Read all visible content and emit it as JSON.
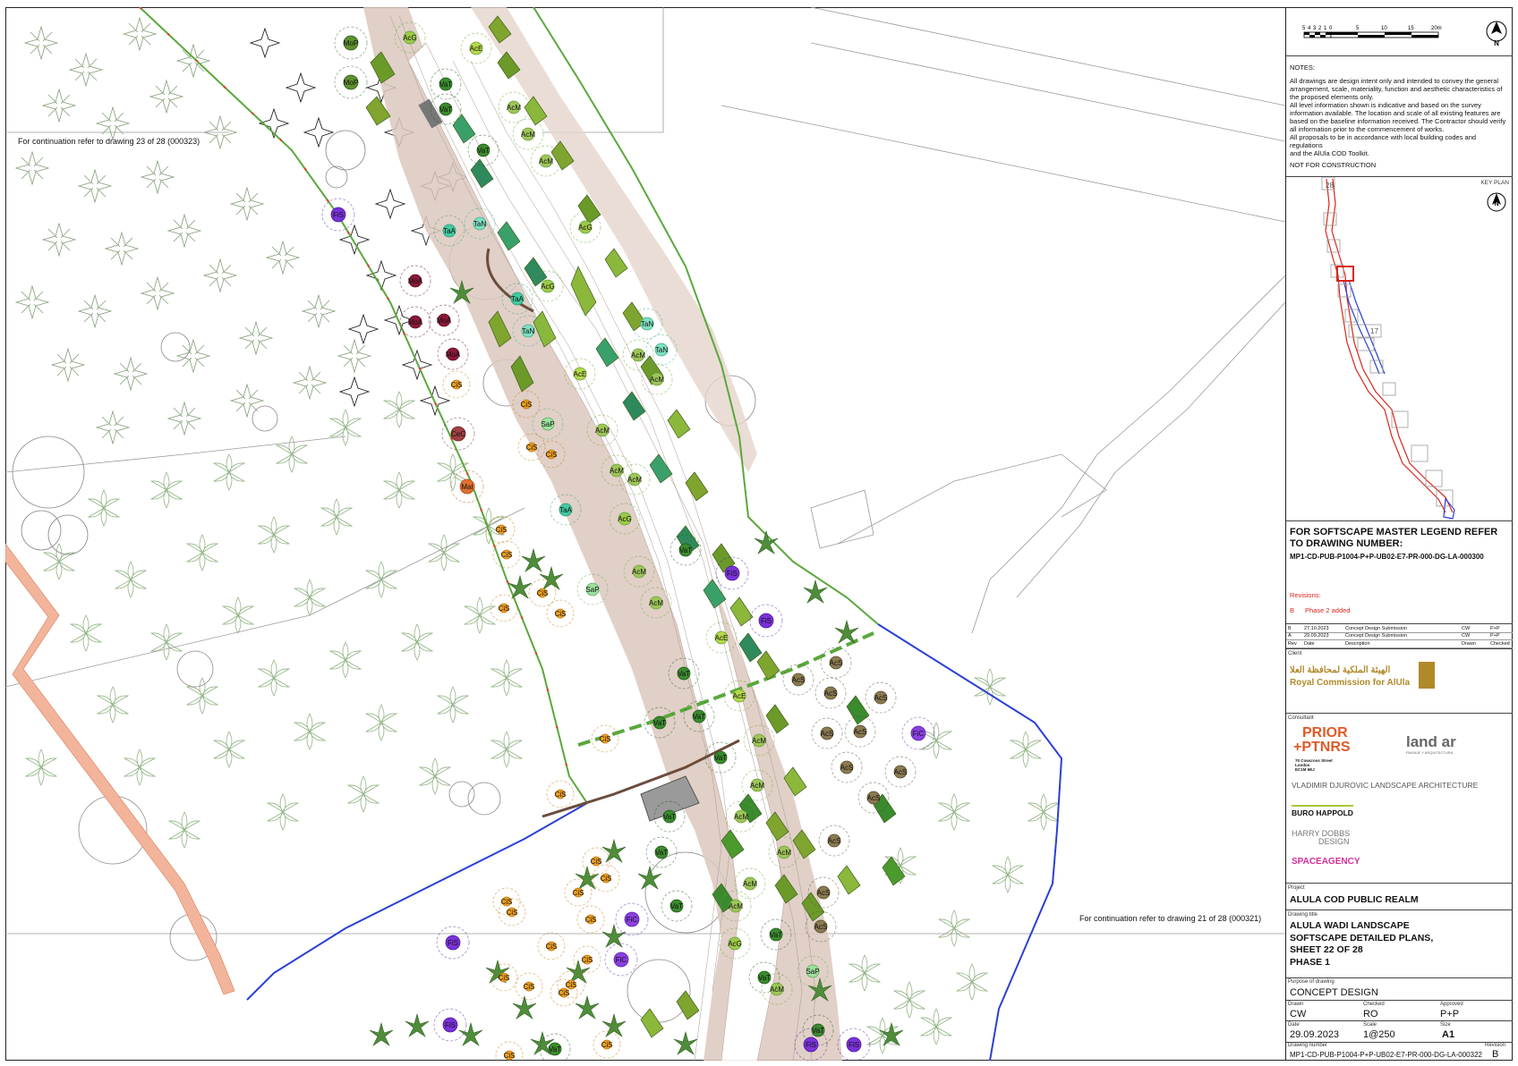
{
  "continuation": {
    "top_left": "For continuation refer to drawing 23 of 28 (000323)",
    "bottom_right": "For continuation refer to drawing 21 of 28 (000321)"
  },
  "scale_bar": {
    "labels": [
      "5",
      "4",
      "3",
      "2",
      "1",
      "0",
      "5",
      "10",
      "15",
      "20m"
    ]
  },
  "north_label": "N",
  "notes": {
    "heading": "NOTES:",
    "lines": [
      "All drawings are design intent only and intended to convey the general",
      "arrangement, scale, materiality, function and aesthetic characteristics of",
      "the proposed elements only.",
      "All level information shown is indicative and based on the survey",
      "information available. The location and scale of all existing features are",
      "based on the baseline information received. The Contractor should verify",
      "all information prior to the commencement of works.",
      "All proposals to be in accordance with local building codes and regulations",
      "and the AlUla COD Toolkit."
    ],
    "footer": "NOT FOR CONSTRUCTION"
  },
  "key_plan": {
    "label": "KEY PLAN",
    "sheet_numbers": [
      "28",
      "17"
    ]
  },
  "legend_ref": {
    "line1": "FOR SOFTSCAPE MASTER LEGEND REFER",
    "line2": "TO DRAWING NUMBER:",
    "line3": "MP1-CD-PUB-P1004-P+P-UB02-E7-PR-000-DG-LA-000300"
  },
  "revisions": {
    "heading": "Revisions:",
    "note_rev": "B",
    "note_text": "Phase 2 added",
    "rows": [
      {
        "rev": "B",
        "date": "27.10.2023",
        "desc": "Concept Design Submission",
        "drawn": "CW",
        "checked": "P+P"
      },
      {
        "rev": "A",
        "date": "29.09.2023",
        "desc": "Concept Design Submission",
        "drawn": "CW",
        "checked": "P+P"
      }
    ],
    "headers": {
      "rev": "Rev",
      "date": "Date",
      "desc": "Description",
      "drawn": "Drawn",
      "checked": "Checked"
    }
  },
  "client": {
    "label": "Client",
    "arabic": "الهيئة الملكية لمحافظة العلا",
    "english": "Royal Commission for AlUla"
  },
  "consultant": {
    "label": "Consultant",
    "prior_line1": "PRIOR",
    "prior_line2": "+PTNRS",
    "prior_addr": [
      "70 Cowcross Street",
      "London",
      "EC1M 6EJ"
    ],
    "landar": "land ar",
    "landar_sub": "PAISAJE Y ARQUITECTURA",
    "vladimir": "VLADIMIR DJUROVIC LANDSCAPE ARCHITECTURE",
    "buro": "BURO HAPPOLD",
    "harry_line1": "HARRY DOBBS",
    "harry_line2": "DESIGN",
    "spaceagency": "SPACEAGENCY"
  },
  "project": {
    "label": "Project",
    "name": "ALULA COD PUBLIC REALM"
  },
  "drawing_title": {
    "label": "Drawing title",
    "lines": [
      "ALULA WADI LANDSCAPE",
      "SOFTSCAPE DETAILED PLANS,",
      "SHEET 22 OF 28",
      "PHASE 1"
    ]
  },
  "purpose": {
    "label": "Purpose of drawing",
    "value": "CONCEPT DESIGN"
  },
  "meta": {
    "drawn_label": "Drawn",
    "drawn": "CW",
    "checked_label": "Checked",
    "checked": "RO",
    "approved_label": "Approved",
    "approved": "P+P",
    "date_label": "Date",
    "date": "29.09.2023",
    "scale_label": "Scale",
    "scale": "1@250",
    "size_label": "Size",
    "size": "A1"
  },
  "drawing_number": {
    "label": "Drawing number",
    "value": "MP1-CD-PUB-P1004-P+P-UB02-E7-PR-000-DG-LA-000322",
    "rev_label": "Revision",
    "rev": "B"
  },
  "colors": {
    "wadi_sand": "#d9c3b8",
    "boundary_green": "#5aa83c",
    "boundary_blue": "#2a3fd6",
    "boundary_red": "#e0402a",
    "palm_dark": "#3a6b2a",
    "acm_green": "#8bb83a",
    "vat_green": "#3b8a2e",
    "fis_purple": "#7a32d8",
    "cis_orange": "#f0a020",
    "moa_maroon": "#8a1838",
    "taa_teal": "#44c9a0",
    "acs_brown": "#8a7a50",
    "walkway_pink": "#f2b59b"
  },
  "plant_labels": [
    {
      "code": "MoP"
    },
    {
      "code": "MoP"
    },
    {
      "code": "AcG"
    },
    {
      "code": "AcE"
    },
    {
      "code": "VaT"
    },
    {
      "code": "VaT"
    },
    {
      "code": "AcM"
    },
    {
      "code": "AcM"
    },
    {
      "code": "AcM"
    },
    {
      "code": "VaT"
    },
    {
      "code": "FiS"
    },
    {
      "code": "TaA"
    },
    {
      "code": "TaN"
    },
    {
      "code": "AcG"
    },
    {
      "code": "MoA"
    },
    {
      "code": "MoA"
    },
    {
      "code": "MoA"
    },
    {
      "code": "MoA"
    },
    {
      "code": "AcG"
    },
    {
      "code": "TaA"
    },
    {
      "code": "TaN"
    },
    {
      "code": "AcM"
    },
    {
      "code": "TaN"
    },
    {
      "code": "TaN"
    },
    {
      "code": "CiS"
    },
    {
      "code": "AcE"
    },
    {
      "code": "AcM"
    },
    {
      "code": "AcM"
    },
    {
      "code": "CiS"
    },
    {
      "code": "SaP"
    },
    {
      "code": "CeC"
    },
    {
      "code": "CiS"
    },
    {
      "code": "CiS"
    },
    {
      "code": "AcM"
    },
    {
      "code": "AcM"
    },
    {
      "code": "MaI"
    },
    {
      "code": "TaA"
    },
    {
      "code": "AcG"
    },
    {
      "code": "CiS"
    },
    {
      "code": "CiS"
    },
    {
      "code": "VaT"
    },
    {
      "code": "FiS"
    },
    {
      "code": "AcM"
    },
    {
      "code": "CiS"
    },
    {
      "code": "SaP"
    },
    {
      "code": "CiS"
    },
    {
      "code": "CiS"
    },
    {
      "code": "AcM"
    },
    {
      "code": "FiS"
    },
    {
      "code": "AcE"
    },
    {
      "code": "VaT"
    },
    {
      "code": "AcS"
    },
    {
      "code": "AcS"
    },
    {
      "code": "AcS"
    },
    {
      "code": "AcS"
    },
    {
      "code": "AcE"
    },
    {
      "code": "VaT"
    },
    {
      "code": "VaT"
    },
    {
      "code": "AcS"
    },
    {
      "code": "AcS"
    },
    {
      "code": "FiC"
    },
    {
      "code": "AcM"
    },
    {
      "code": "CiS"
    },
    {
      "code": "VaT"
    },
    {
      "code": "AcS"
    },
    {
      "code": "AcS"
    },
    {
      "code": "CiS"
    },
    {
      "code": "AcM"
    },
    {
      "code": "AcS"
    },
    {
      "code": "VaT"
    },
    {
      "code": "AcM"
    },
    {
      "code": "AcM"
    },
    {
      "code": "VaT"
    },
    {
      "code": "AcS"
    },
    {
      "code": "VaT"
    },
    {
      "code": "CiS"
    },
    {
      "code": "CiS"
    },
    {
      "code": "AcM"
    },
    {
      "code": "AcM"
    },
    {
      "code": "AcS"
    },
    {
      "code": "CiS"
    },
    {
      "code": "CiS"
    },
    {
      "code": "CiS"
    },
    {
      "code": "AcM"
    },
    {
      "code": "CiS"
    },
    {
      "code": "FiC"
    },
    {
      "code": "AcS"
    },
    {
      "code": "CiS"
    },
    {
      "code": "FiS"
    },
    {
      "code": "CiS"
    },
    {
      "code": "CiS"
    },
    {
      "code": "FiC"
    },
    {
      "code": "AcG"
    },
    {
      "code": "VaT"
    },
    {
      "code": "CiS"
    },
    {
      "code": "CiS"
    },
    {
      "code": "CiS"
    },
    {
      "code": "VaT"
    },
    {
      "code": "SaP"
    },
    {
      "code": "FiS"
    },
    {
      "code": "CiS"
    },
    {
      "code": "VaT"
    },
    {
      "code": "FiS"
    },
    {
      "code": "CiS"
    },
    {
      "code": "VaT"
    },
    {
      "code": "FiS"
    }
  ]
}
